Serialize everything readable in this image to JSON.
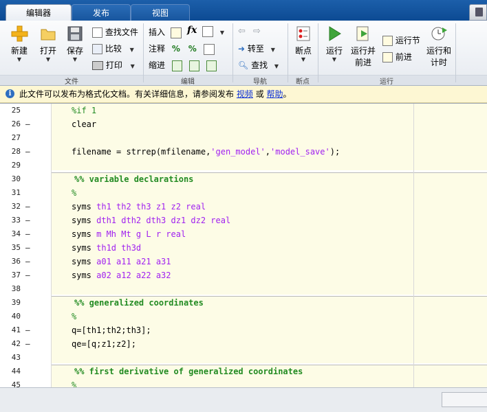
{
  "tabs": [
    {
      "label": "编辑器",
      "active": true
    },
    {
      "label": "发布",
      "active": false
    },
    {
      "label": "视图",
      "active": false
    }
  ],
  "ribbon": {
    "file": {
      "new_label": "新建",
      "open_label": "打开",
      "save_label": "保存",
      "find_files_label": "查找文件",
      "compare_label": "比较",
      "print_label": "打印",
      "group_label": "文件"
    },
    "edit": {
      "insert_label": "插入",
      "comment_label": "注释",
      "indent_label": "缩进",
      "fx_label": "fx",
      "group_label": "编辑"
    },
    "navigate": {
      "goto_label": "转至",
      "find_label": "查找",
      "group_label": "导航"
    },
    "breakpoints": {
      "breakpoints_label": "断点",
      "group_label": "断点"
    },
    "run": {
      "run_label": "运行",
      "run_advance_label_1": "运行并",
      "run_advance_label_2": "前进",
      "run_section_label": "运行节",
      "advance_label": "前进",
      "run_time_label_1": "运行和",
      "run_time_label_2": "计时",
      "group_label": "运行"
    }
  },
  "notice": {
    "text": "此文件可以发布为格式化文档。有关详细信息，请参阅发布",
    "video_link": "视频",
    "or_text": "或",
    "help_link": "帮助",
    "end_text": "。"
  },
  "code_lines": [
    {
      "num": "25",
      "dash": false,
      "text": "%if 1"
    },
    {
      "num": "26",
      "dash": true,
      "text": "clear"
    },
    {
      "num": "27",
      "dash": false,
      "text": ""
    },
    {
      "num": "28",
      "dash": true,
      "text": "filename = strrep(mfilename,'gen_model','model_save');"
    },
    {
      "num": "29",
      "dash": false,
      "text": ""
    },
    {
      "num": "30",
      "dash": false,
      "text": "%% variable declarations"
    },
    {
      "num": "31",
      "dash": false,
      "text": "%"
    },
    {
      "num": "32",
      "dash": true,
      "text": "syms th1 th2 th3 z1 z2 real"
    },
    {
      "num": "33",
      "dash": true,
      "text": "syms dth1 dth2 dth3 dz1 dz2 real"
    },
    {
      "num": "34",
      "dash": true,
      "text": "syms m Mh Mt g L r real"
    },
    {
      "num": "35",
      "dash": true,
      "text": "syms th1d th3d"
    },
    {
      "num": "36",
      "dash": true,
      "text": "syms a01 a11 a21 a31"
    },
    {
      "num": "37",
      "dash": true,
      "text": "syms a02 a12 a22 a32"
    },
    {
      "num": "38",
      "dash": false,
      "text": ""
    },
    {
      "num": "39",
      "dash": false,
      "text": "%% generalized coordinates"
    },
    {
      "num": "40",
      "dash": false,
      "text": "%"
    },
    {
      "num": "41",
      "dash": true,
      "text": "q=[th1;th2;th3];"
    },
    {
      "num": "42",
      "dash": true,
      "text": "qe=[q;z1;z2];"
    },
    {
      "num": "43",
      "dash": false,
      "text": ""
    },
    {
      "num": "44",
      "dash": false,
      "text": "%% first derivative of generalized coordinates"
    },
    {
      "num": "45",
      "dash": false,
      "text": "%"
    }
  ],
  "colors": {
    "comment": "#228b22",
    "string": "#a020f0",
    "cell_bg": "#fdfce6",
    "tab_strip": "#1c5faa"
  }
}
